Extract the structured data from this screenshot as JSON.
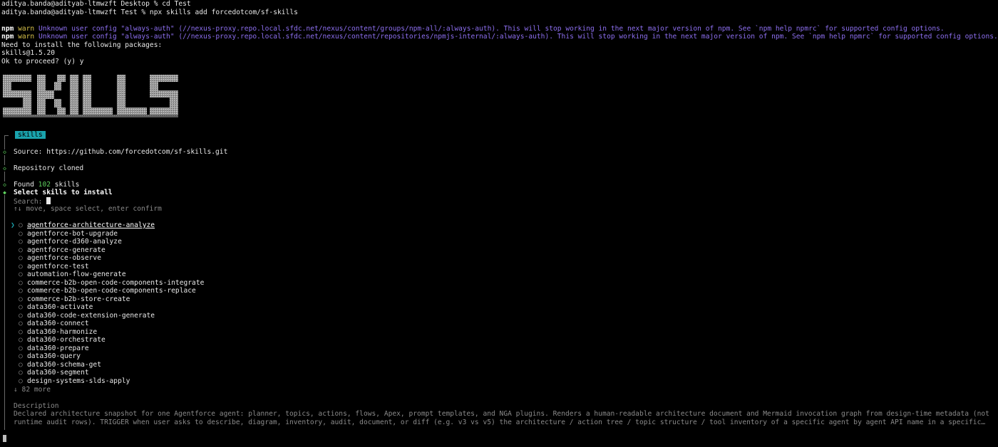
{
  "terminal": {
    "lines": {
      "cmd1": "aditya.banda@adityab-ltmwzft Desktop % cd Test",
      "cmd2": "aditya.banda@adityab-ltmwzft Test % npx skills add forcedotcom/sf-skills",
      "warn1_prefix": "npm",
      "warn1_level": "warn",
      "warn1_msg": "Unknown user config \"always-auth\" (//nexus-proxy.repo.local.sfdc.net/nexus/content/groups/npm-all/:always-auth). This will stop working in the next major version of npm. See `npm help npmrc` for supported config options.",
      "warn2_prefix": "npm",
      "warn2_level": "warn",
      "warn2_msg": "Unknown user config \"always-auth\" (//nexus-proxy.repo.local.sfdc.net/nexus/content/repositories/npmjs-internal/:always-auth). This will stop working in the next major version of npm. See `npm help npmrc` for supported config options.",
      "need_install": "Need to install the following packages:",
      "package": "skills@1.5.20",
      "proceed": "Ok to proceed? (y) y"
    },
    "badge": "skills",
    "source": "Source: https://github.com/forcedotcom/sf-skills.git",
    "cloned": "Repository cloned",
    "found_prefix": "Found",
    "found_count": "102",
    "found_suffix": "skills",
    "select_title": "Select skills to install",
    "search_label": "Search:",
    "hint": "↑↓ move, space select, enter confirm",
    "more": "↓ 82 more",
    "description_label": "Description",
    "description_line1": "Declared architecture snapshot for one Agentforce agent: planner, topics, actions, flows, Apex, prompt templates, and NGA plugins. Renders a human-readable architecture document and Mermaid invocation graph from design-time metadata (not",
    "description_line2": "runtime audit rows). TRIGGER when user asks to describe, diagram, inventory, audit, document, or diff (e.g. v3 vs v5) the architecture / action tree / topic structure / tool inventory of a specific agent by agent API name in a specific…",
    "skills": [
      "agentforce-architecture-analyze",
      "agentforce-bot-upgrade",
      "agentforce-d360-analyze",
      "agentforce-generate",
      "agentforce-observe",
      "agentforce-test",
      "automation-flow-generate",
      "commerce-b2b-open-code-components-integrate",
      "commerce-b2b-open-code-components-replace",
      "commerce-b2b-store-create",
      "data360-activate",
      "data360-code-extension-generate",
      "data360-connect",
      "data360-harmonize",
      "data360-orchestrate",
      "data360-prepare",
      "data360-query",
      "data360-schema-get",
      "data360-segment",
      "design-systems-slds-apply"
    ],
    "pointer_glyph": "❯",
    "radio_glyph": "○",
    "step_glyph": "◇",
    "active_glyph": "◆"
  },
  "colors": {
    "background": "#000000",
    "accent": "#1aa3ad",
    "warn": "#d6c04a",
    "warn_message": "#8d6ff0",
    "success": "#5fd35f",
    "dim": "#8a8a8a"
  }
}
